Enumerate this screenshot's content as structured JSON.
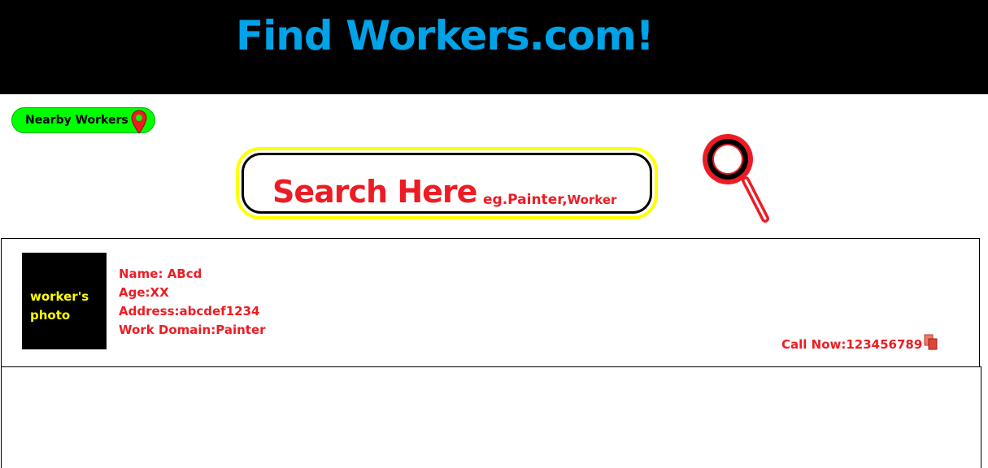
{
  "header": {
    "title": "Find Workers.com!"
  },
  "nearby": {
    "label": "Nearby Workers"
  },
  "search": {
    "placeholder": "Search Here",
    "hint_main": "eg.Painter,",
    "hint_small": "Worker"
  },
  "worker": {
    "photo_label": "worker's photo",
    "name": "Name: ABcd",
    "age": "Age:XX",
    "address": "Address:abcdef1234",
    "work_domain": "Work Domain:Painter",
    "call": "Call Now:123456789"
  },
  "icons": {
    "nearby": "location-pin-icon",
    "search": "magnifier-icon",
    "call": "copy-icon"
  },
  "colors": {
    "header_bg": "#000000",
    "title": "#00a2e8",
    "accent_red": "#ed1c24",
    "nearby_bg": "#00ff00",
    "search_border": "#ffff00",
    "photo_text": "#ffff00"
  }
}
